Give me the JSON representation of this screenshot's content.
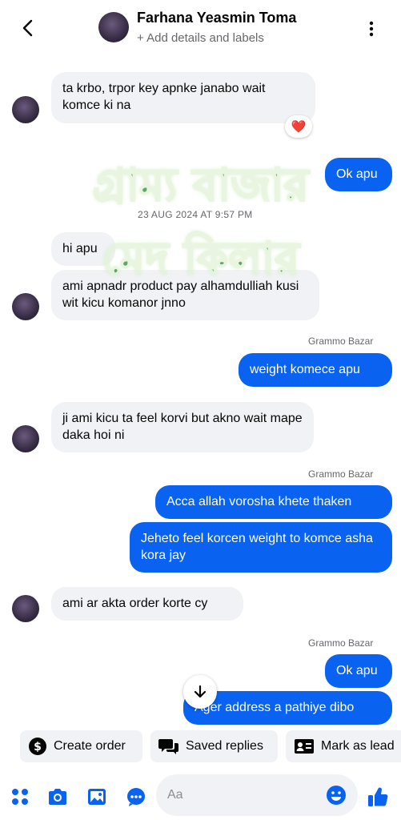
{
  "header": {
    "contact_name": "Farhana Yeasmin Toma",
    "subtitle": "+ Add details and labels",
    "back_icon": "chevron-left-icon",
    "menu_icon": "kebab-menu-icon"
  },
  "messages": [
    {
      "from": "them",
      "text": "ta krbo, trpor  key apnke janabo wait komce ki na",
      "reaction": "❤️"
    },
    {
      "from": "me",
      "text": "Ok apu"
    },
    {
      "timestamp": "23 AUG 2024 AT 9:57 PM"
    },
    {
      "from": "them",
      "text": "hi apu"
    },
    {
      "from": "them",
      "text": "ami apnadr product pay alhamdulliah kusi wit kicu komanor jnno"
    },
    {
      "sender_label": "Grammo Bazar"
    },
    {
      "from": "me",
      "text": "weight komece apu"
    },
    {
      "from": "them",
      "text": "ji ami kicu ta feel korvi but akno wait mape daka hoi ni"
    },
    {
      "sender_label": "Grammo Bazar"
    },
    {
      "from": "me",
      "text": "Acca allah vorosha khete thaken"
    },
    {
      "from": "me",
      "text": "Jeheto feel korcen weight to komce asha kora jay"
    },
    {
      "from": "them",
      "text": "ami ar akta order korte cy"
    },
    {
      "sender_label": "Grammo Bazar"
    },
    {
      "from": "me",
      "text": "Ok apu"
    },
    {
      "from": "me",
      "text": "Ager address a pathiye dibo"
    }
  ],
  "watermark": {
    "line1": "গ্রাম্য বাজার",
    "line2": "মেদ কিলার"
  },
  "quick_actions": [
    {
      "label": "Create order",
      "icon": "dollar-icon"
    },
    {
      "label": "Saved replies",
      "icon": "chat-bubbles-icon"
    },
    {
      "label": "Mark as lead",
      "icon": "id-card-icon"
    }
  ],
  "composer": {
    "placeholder": "Aa",
    "icons": [
      "apps-icon",
      "camera-icon",
      "gallery-icon",
      "message-icon",
      "emoji-icon",
      "thumbs-up-icon"
    ]
  },
  "colors": {
    "accent": "#0a63f0",
    "incoming_bubble": "#f0f2f5",
    "watermark": "#2f8f3f",
    "reaction": "#e41e3f"
  }
}
